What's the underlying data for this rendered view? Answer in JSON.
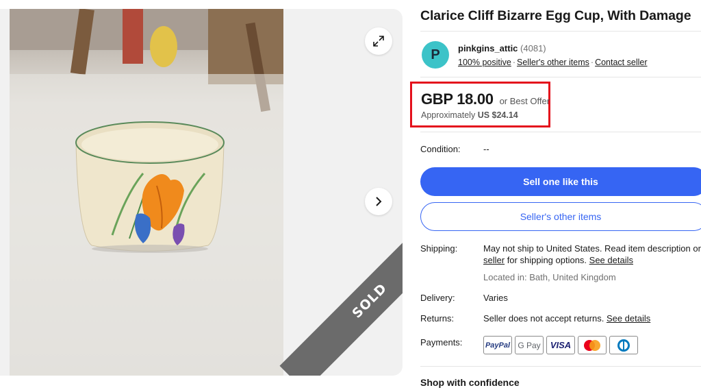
{
  "listing": {
    "title": "Clarice Cliff Bizarre Egg Cup, With Damage",
    "sold_label": "SOLD"
  },
  "seller": {
    "avatar_letter": "P",
    "name": "pinkgins_attic",
    "feedback_count": "(4081)",
    "positive": "100% positive",
    "other_items_link": "Seller's other items",
    "contact_link": "Contact seller",
    "separator": "·"
  },
  "price": {
    "amount": "GBP 18.00",
    "offer": "or Best Offer",
    "approx_prefix": "Approximately",
    "approx_value": "US $24.14"
  },
  "condition": {
    "label": "Condition:",
    "value": "--"
  },
  "buttons": {
    "sell_one": "Sell one like this",
    "sellers_other_items": "Seller's other items"
  },
  "shipping": {
    "label": "Shipping:",
    "line1": "May not ship to United States. Read item description or c",
    "line2_link": "seller",
    "line2_text": " for shipping options. ",
    "see_details": "See details",
    "location": "Located in: Bath, United Kingdom"
  },
  "delivery": {
    "label": "Delivery:",
    "value": "Varies"
  },
  "returns": {
    "label": "Returns:",
    "value": "Seller does not accept returns. ",
    "see_details": "See details"
  },
  "payments": {
    "label": "Payments:",
    "methods": [
      "PayPal",
      "G Pay",
      "VISA",
      "Mastercard",
      "Diners Club"
    ]
  },
  "shop_with_confidence": "Shop with confidence",
  "colors": {
    "accent_blue": "#3665f3",
    "highlight_red": "#e4101c",
    "avatar_teal": "#3cc3c8",
    "sold_ribbon": "#6b6b6b"
  },
  "icons": [
    "expand-icon",
    "chevron-right-icon",
    "paypal-icon",
    "google-pay-icon",
    "visa-icon",
    "mastercard-icon",
    "diners-club-icon"
  ]
}
